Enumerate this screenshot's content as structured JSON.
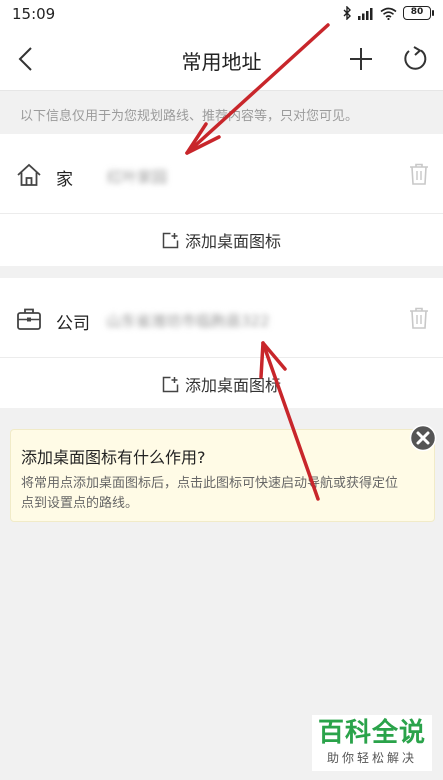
{
  "status_bar": {
    "time": "15:09",
    "battery": "80"
  },
  "header": {
    "title": "常用地址"
  },
  "notice": "以下信息仅用于为您规划路线、推荐内容等，只对您可见。",
  "places": [
    {
      "label": "家",
      "address": "红叶家园",
      "action_label": "添加桌面图标"
    },
    {
      "label": "公司",
      "address": "山东省潍坊市临朐县322",
      "action_label": "添加桌面图标"
    }
  ],
  "tip": {
    "title": "添加桌面图标有什么作用?",
    "body": "将常用点添加桌面图标后，点击此图标可快速启动导航或获得定位点到设置点的路线。"
  },
  "watermark": {
    "main": "百科全说",
    "sub": "助你轻松解决"
  },
  "colors": {
    "annotation_arrow": "#c8262b",
    "watermark_green": "#2aa34a",
    "tip_background": "#fffbe6"
  }
}
